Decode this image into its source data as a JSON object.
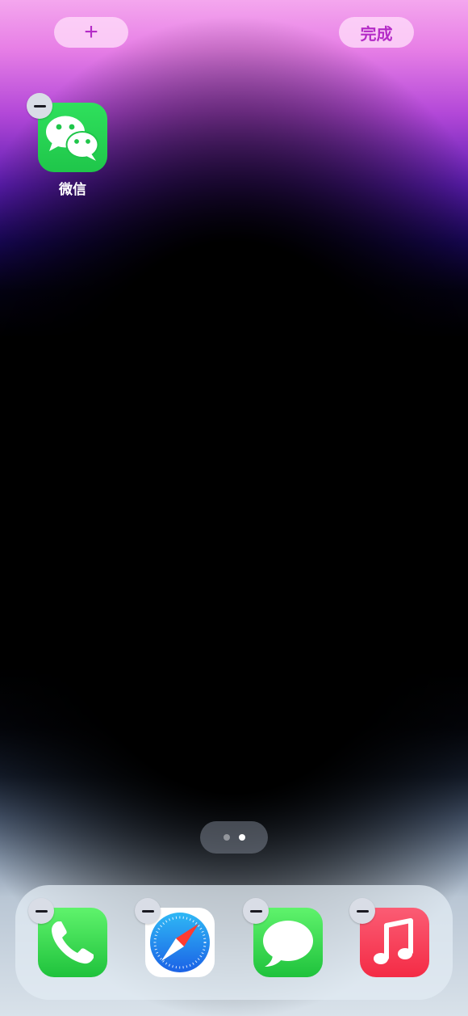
{
  "top_bar": {
    "add_label": "+",
    "done_label": "完成"
  },
  "home_apps": [
    {
      "label": "微信",
      "icon": "wechat-icon"
    }
  ],
  "page_indicator": {
    "pages": 2,
    "current": 2
  },
  "dock_apps": [
    {
      "name": "phone",
      "icon": "phone-icon"
    },
    {
      "name": "safari",
      "icon": "compass-icon"
    },
    {
      "name": "messages",
      "icon": "message-bubble-icon"
    },
    {
      "name": "music",
      "icon": "music-note-icon"
    }
  ],
  "colors": {
    "wechat_green": "#2dc100",
    "phone_green": "#3ad94c",
    "messages_green": "#2fd14a",
    "safari_blue": "#1e7ef0",
    "music_red": "#f83a54",
    "accent_magenta": "#b42cc7"
  }
}
